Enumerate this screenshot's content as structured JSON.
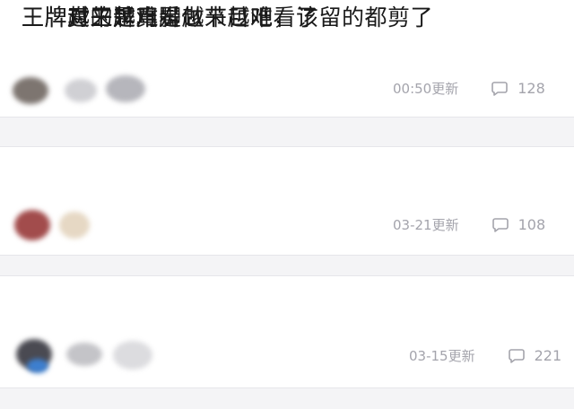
{
  "posts": [
    {
      "title": "王牌对王牌真是越来越难看了",
      "time": "00:50",
      "update_label": "更新",
      "comments": "128"
    },
    {
      "title": "王牌真的是用脚做节目吧，该留的都剪了",
      "time": "03-21",
      "update_label": "更新",
      "comments": "108"
    },
    {
      "title": "王牌越来越难看",
      "time": "03-15",
      "update_label": "更新",
      "comments": "221"
    }
  ],
  "colors": {
    "background": "#f4f4f6",
    "card": "#ffffff",
    "title_text": "#1a1a1a",
    "meta_text": "#a4a4ac"
  },
  "icons": [
    "comment-bubble-icon"
  ]
}
